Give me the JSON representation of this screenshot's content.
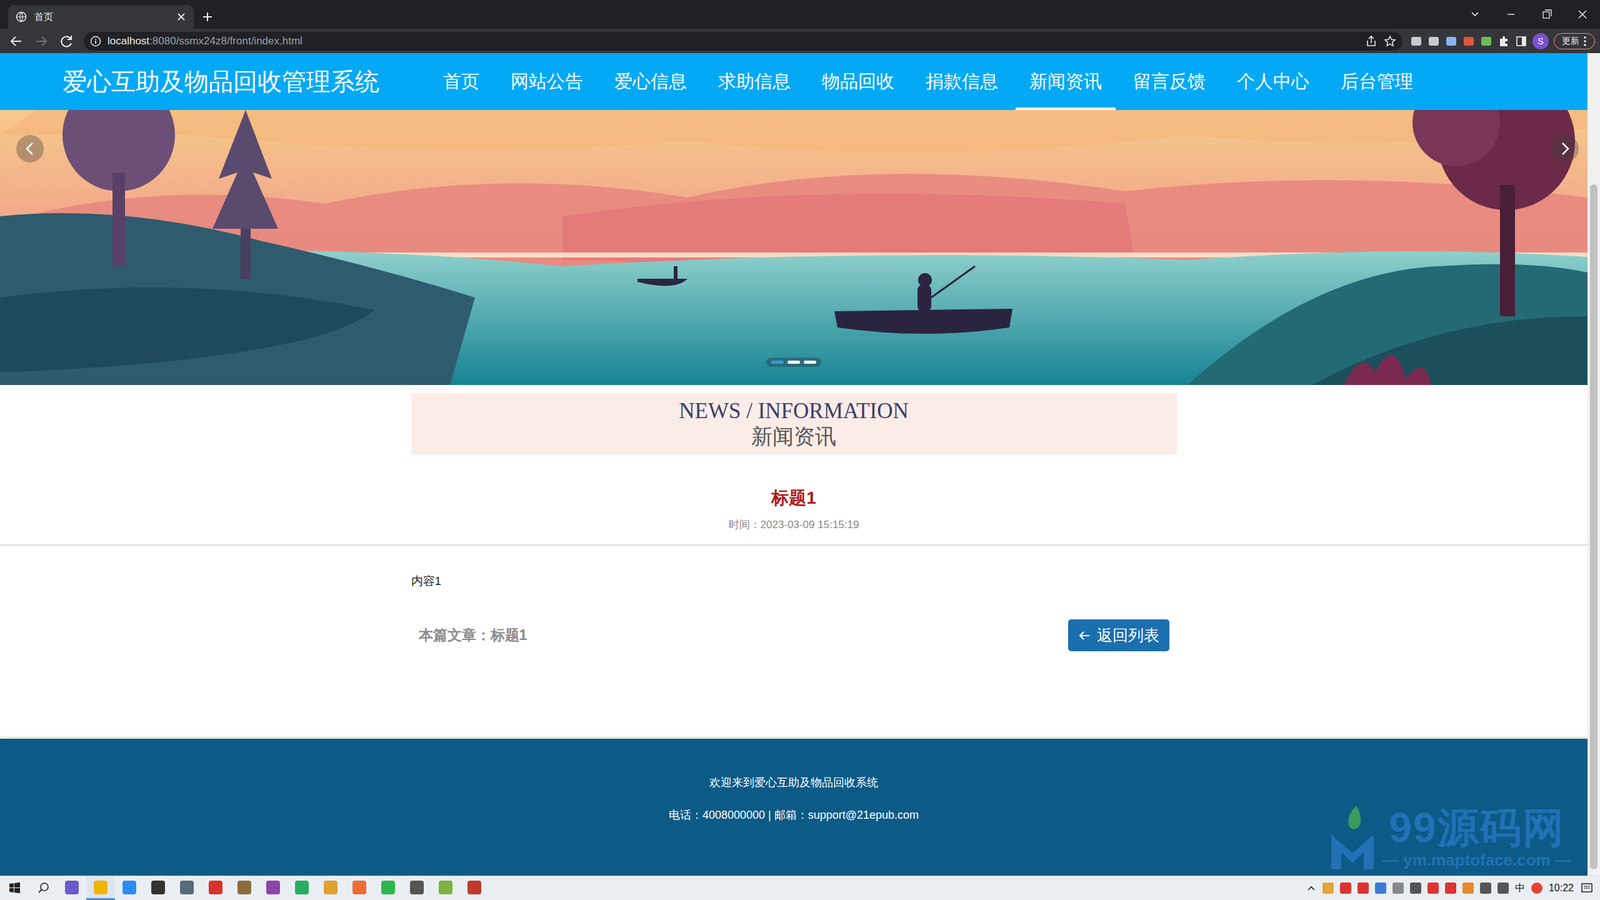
{
  "browser": {
    "tab": {
      "title": "首页"
    },
    "address": {
      "host": "localhost",
      "path": ":8080/ssmx24z8/front/index.html"
    },
    "profile": "S",
    "update_button": "更新"
  },
  "site": {
    "title": "爱心互助及物品回收管理系统",
    "nav": [
      {
        "label": "首页",
        "selected": false
      },
      {
        "label": "网站公告",
        "selected": false
      },
      {
        "label": "爱心信息",
        "selected": false
      },
      {
        "label": "求助信息",
        "selected": false
      },
      {
        "label": "物品回收",
        "selected": false
      },
      {
        "label": "捐款信息",
        "selected": false
      },
      {
        "label": "新闻资讯",
        "selected": true
      },
      {
        "label": "留言反馈",
        "selected": false
      },
      {
        "label": "个人中心",
        "selected": false
      },
      {
        "label": "后台管理",
        "selected": false
      }
    ]
  },
  "carousel": {
    "indicators": [
      {
        "selected": true
      },
      {
        "selected": false
      },
      {
        "selected": false
      }
    ]
  },
  "section": {
    "en": "NEWS / INFORMATION",
    "cn": "新闻资讯"
  },
  "article": {
    "title": "标题1",
    "time": "时间：2023-03-09 15:15:19",
    "content": "内容1",
    "current": "本篇文章：标题1",
    "back_button": "返回列表"
  },
  "footer": {
    "welcome": "欢迎来到爱心互助及物品回收系统",
    "contact": "电话：4008000000 | 邮箱：support@21epub.com"
  },
  "watermark": {
    "name": "99源码网",
    "url": "— ym.maptoface.com —"
  },
  "taskbar": {
    "apps": [
      {
        "active": false
      },
      {
        "active": true
      },
      {
        "active": false
      },
      {
        "active": false
      },
      {
        "active": false
      },
      {
        "active": false
      },
      {
        "active": false
      },
      {
        "active": false
      },
      {
        "active": false
      },
      {
        "active": false
      },
      {
        "active": false
      },
      {
        "active": false
      },
      {
        "active": false
      },
      {
        "active": false
      },
      {
        "active": false
      }
    ],
    "ime": "中",
    "clock": "10:22"
  }
}
